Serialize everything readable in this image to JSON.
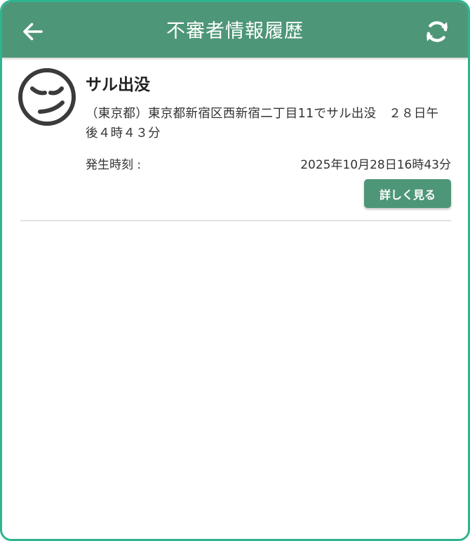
{
  "header": {
    "title": "不審者情報履歴",
    "back_icon": "arrow-left-icon",
    "refresh_icon": "refresh-icon"
  },
  "items": [
    {
      "icon": "sneaky-face-icon",
      "title": "サル出没",
      "description": "（東京都）東京都新宿区西新宿二丁目11でサル出没　２８日午後４時４３分",
      "time_label": "発生時刻 :",
      "time_value": "2025年10月28日16時43分",
      "button_label": "詳しく見る"
    }
  ],
  "colors": {
    "header_bg": "#4e9678",
    "frame_border": "#2db58f",
    "button_bg": "#4e9678"
  }
}
